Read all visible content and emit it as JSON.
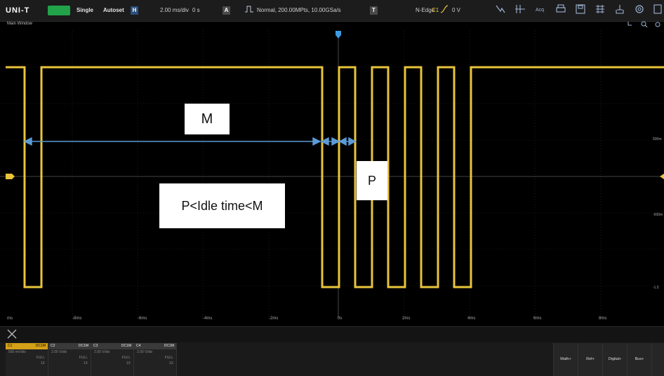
{
  "topbar": {
    "logo": "UNI-T",
    "run_label": "",
    "single": "Single",
    "autoset": "Autoset",
    "h_badge": "H",
    "timebase": "2.00 ms/div",
    "offset": "0 s",
    "a_badge": "A",
    "acquire": "Normal, 200.00MPts, 10.00GSa/s",
    "t_badge": "T",
    "trigger_type": "N-Edge",
    "trigger_level": "0 V",
    "icons": [
      "cursor-icon",
      "measure-icon",
      "acquire-icon",
      "print-icon",
      "save-icon",
      "display-icon",
      "utility-icon",
      "settings-icon"
    ],
    "acq_label": "Acq"
  },
  "window_title": "Main Window",
  "x_ticks": [
    "ms",
    "-8ms",
    "-6ms",
    "-4ms",
    "-2ms",
    "0s",
    "2ms",
    "4ms",
    "6ms",
    "8ms"
  ],
  "y_labels": [
    "500m",
    "-500m",
    "-1.5"
  ],
  "callouts": {
    "m": "M",
    "p": "P",
    "idle": "P<Idle time<M"
  },
  "channels": [
    {
      "name": "C1",
      "coupling": "DC1M",
      "scale": "500 mV/div",
      "bw": "FULL",
      "probe": "1X"
    },
    {
      "name": "C2",
      "coupling": "DC1M",
      "scale": "2.00 V/div",
      "bw": "FULL",
      "probe": "1X"
    },
    {
      "name": "C3",
      "coupling": "DC1M",
      "scale": "2.00 V/div",
      "bw": "FULL",
      "probe": "1X"
    },
    {
      "name": "C4",
      "coupling": "DC1M",
      "scale": "2.00 V/div",
      "bw": "FULL",
      "probe": "1X"
    }
  ],
  "right_buttons": [
    "Math+",
    "Ref+",
    "Digital+",
    "Bus+"
  ],
  "colors": {
    "trace": "#e8c43a",
    "arrow": "#5b9bd5",
    "grid": "#3a3a3a",
    "ch1_header": "#d4a017",
    "run_green": "#22a24a"
  }
}
